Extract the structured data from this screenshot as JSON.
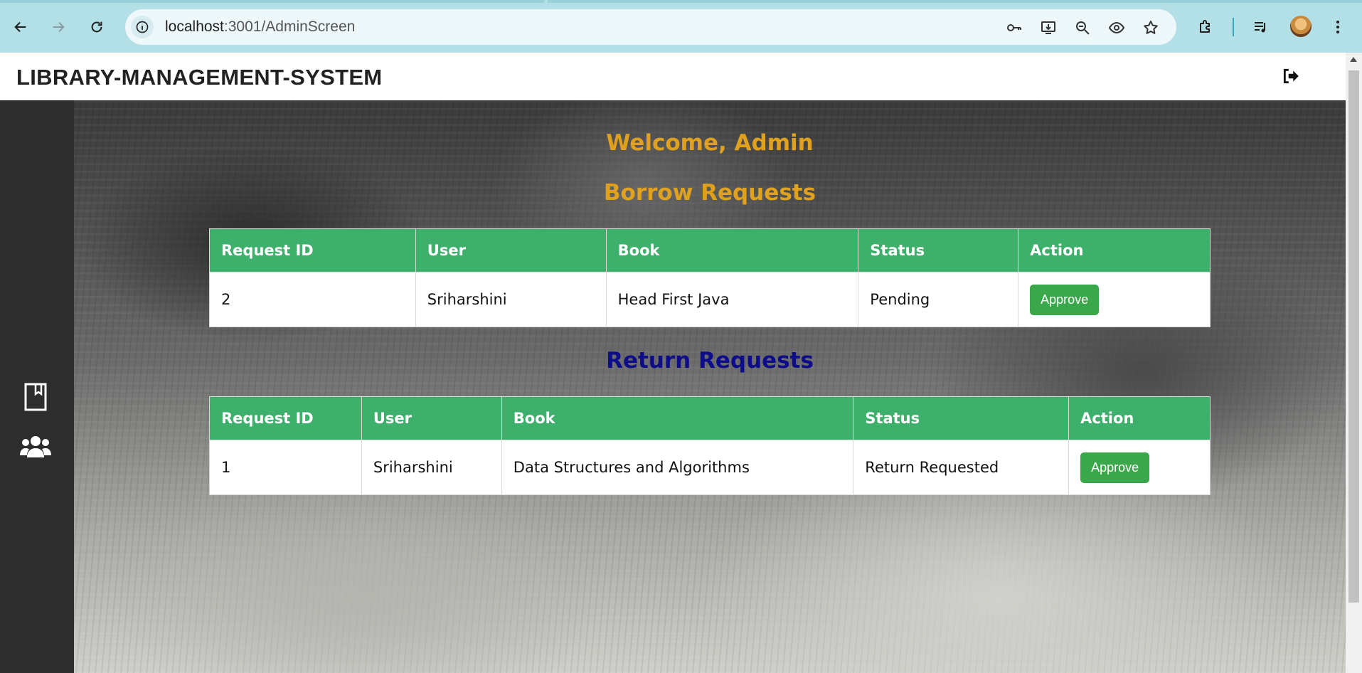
{
  "browser": {
    "url_host": "localhost",
    "url_path": ":3001/AdminScreen",
    "icons": [
      "back-icon",
      "forward-icon",
      "reload-icon",
      "site-info-icon",
      "password-key-icon",
      "install-app-icon",
      "zoom-icon",
      "eye-icon",
      "bookmark-star-icon",
      "extensions-icon",
      "media-controls-icon",
      "profile-avatar",
      "more-menu-icon"
    ]
  },
  "header": {
    "title": "LIBRARY-MANAGEMENT-SYSTEM",
    "logout_icon": "sign-out-icon"
  },
  "sidebar": {
    "items": [
      {
        "icon": "bookmark-icon"
      },
      {
        "icon": "users-icon"
      }
    ]
  },
  "main": {
    "welcome": "Welcome, Admin",
    "borrow": {
      "title": "Borrow Requests",
      "columns": [
        "Request ID",
        "User",
        "Book",
        "Status",
        "Action"
      ],
      "rows": [
        {
          "id": "2",
          "user": "Sriharshini",
          "book": "Head First Java",
          "status": "Pending",
          "action": "Approve"
        }
      ]
    },
    "return": {
      "title": "Return Requests",
      "columns": [
        "Request ID",
        "User",
        "Book",
        "Status",
        "Action"
      ],
      "rows": [
        {
          "id": "1",
          "user": "Sriharshini",
          "book": "Data Structures and Algorithms",
          "status": "Return Requested",
          "action": "Approve"
        }
      ]
    }
  },
  "colors": {
    "header_green": "#3db06b",
    "button_green": "#3aa84a",
    "welcome_gold": "#e0a21e",
    "return_title_navy": "#0d0d8a",
    "sidebar": "#2d2d2d",
    "chrome": "#b3dfe6"
  }
}
